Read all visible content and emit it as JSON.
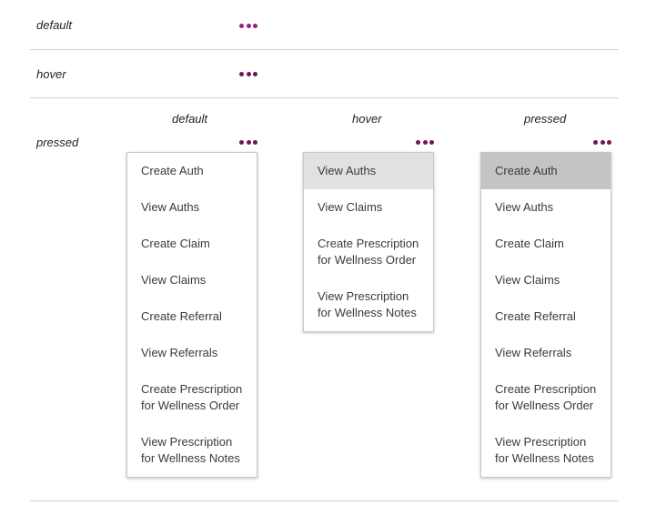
{
  "rows": {
    "default_label": "default",
    "hover_label": "hover",
    "pressed_label": "pressed"
  },
  "columns": {
    "default_label": "default",
    "hover_label": "hover",
    "pressed_label": "pressed"
  },
  "colors": {
    "dots": "#9b1f7a",
    "dots_dark": "#6e1658",
    "hover_item": "#e1e1e1",
    "pressed_item": "#c4c4c4"
  },
  "icons": {
    "more": "more-horizontal-icon"
  },
  "menus": {
    "default": [
      "Create Auth",
      "View Auths",
      "Create Claim",
      "View Claims",
      "Create Referral",
      "View Referrals",
      "Create Prescription for Wellness Order",
      "View Prescription for Wellness Notes"
    ],
    "hover": [
      "View Auths",
      "View Claims",
      "Create Prescription for Wellness Order",
      "View Prescription for Wellness Notes"
    ],
    "pressed": [
      "Create Auth",
      "View Auths",
      "Create Claim",
      "View Claims",
      "Create Referral",
      "View Referrals",
      "Create Prescription for Wellness Order",
      "View Prescription for Wellness Notes"
    ]
  }
}
